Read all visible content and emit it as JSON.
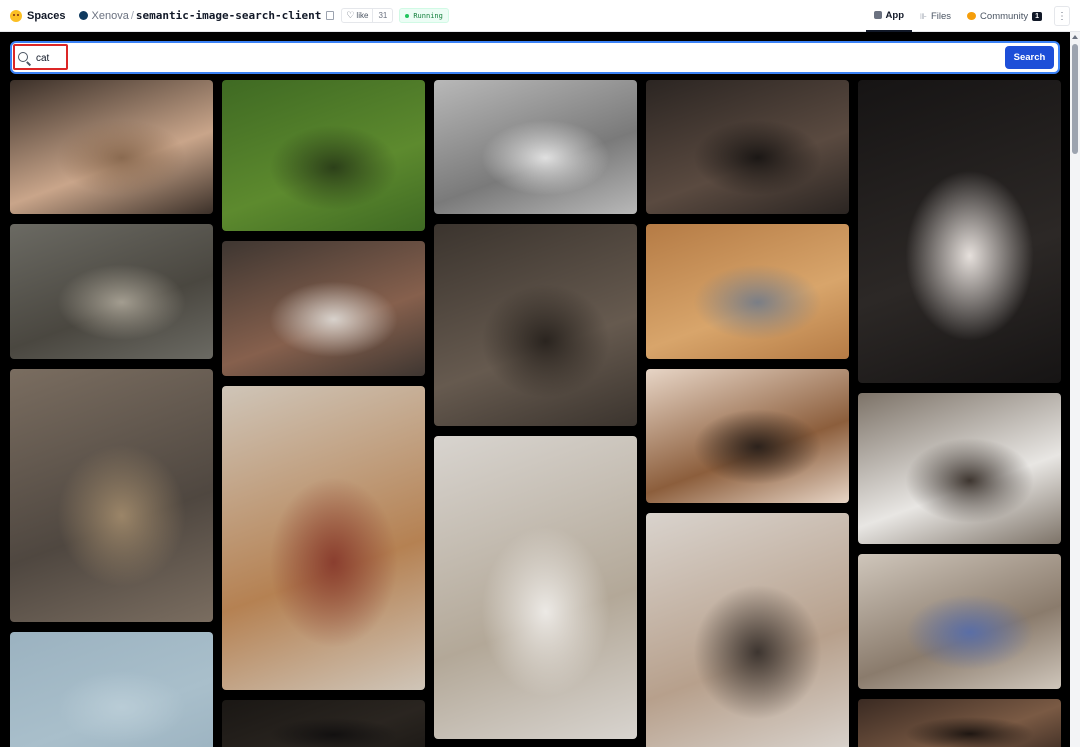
{
  "header": {
    "brand": "Spaces",
    "owner": "Xenova",
    "separator": "/",
    "repo": "semantic-image-search-client",
    "like_label": "like",
    "like_count": "31",
    "status": "Running",
    "tabs": [
      {
        "label": "App",
        "icon": "app-icon",
        "active": true
      },
      {
        "label": "Files",
        "icon": "files-icon",
        "active": false
      },
      {
        "label": "Community",
        "icon": "community-icon",
        "active": false,
        "badge": "1"
      }
    ]
  },
  "search": {
    "value": "cat",
    "button_label": "Search",
    "accent_color": "#3b82f6",
    "button_color": "#1d4ed8"
  },
  "results": {
    "columns": [
      [
        {
          "desc": "ginger cat sleeping on a wooden shelf by a window",
          "colors": [
            "#3b3029",
            "#c9a58a",
            "#8a6a50"
          ]
        },
        {
          "desc": "tabby cat walking on a cobblestone street",
          "colors": [
            "#6b6a63",
            "#4a4740",
            "#a39d90"
          ]
        },
        {
          "desc": "tabby cat peeking out of a cardboard box",
          "colors": [
            "#7a6d60",
            "#4f4740",
            "#9b8568"
          ]
        },
        {
          "desc": "pale blue sky",
          "colors": [
            "#9bb2c0",
            "#a9bfcb",
            "#b9ccd6"
          ]
        }
      ],
      [
        {
          "desc": "tortoiseshell cat standing in green grass",
          "colors": [
            "#3f6a23",
            "#5d8a2e",
            "#2c4019"
          ]
        },
        {
          "desc": "white cat walking near flower pots",
          "colors": [
            "#3e3631",
            "#86604d",
            "#d8d2cc"
          ]
        },
        {
          "desc": "orange cat sitting on a red tiled floor",
          "colors": [
            "#cfc5b8",
            "#b58152",
            "#8a3e2f"
          ]
        },
        {
          "desc": "dark indoor scene",
          "colors": [
            "#1a1714",
            "#2a2520",
            "#121010"
          ]
        }
      ],
      [
        {
          "desc": "black and white photo of a tabby cat on a sidewalk",
          "colors": [
            "#b8b8b8",
            "#7a7a7a",
            "#e0e0e0"
          ]
        },
        {
          "desc": "grey tabby cat close-up by a scratching post",
          "colors": [
            "#3b342e",
            "#665a4f",
            "#2a241f"
          ]
        },
        {
          "desc": "tabby cat sleeping on a beige couch",
          "colors": [
            "#d8d4cf",
            "#b3a898",
            "#ece9e5"
          ]
        }
      ],
      [
        {
          "desc": "black and white cat lying on a bed",
          "colors": [
            "#2b2522",
            "#5a4a40",
            "#1b1715"
          ]
        },
        {
          "desc": "grey British shorthair lying on a wooden floor",
          "colors": [
            "#b57b45",
            "#d8a56b",
            "#7a7e86"
          ]
        },
        {
          "desc": "tabby cat crouching under a chair",
          "colors": [
            "#e7d5c6",
            "#8c5e3c",
            "#2c221c"
          ]
        },
        {
          "desc": "siamese cat sitting by a window",
          "colors": [
            "#d9d3cd",
            "#b7a08c",
            "#3d3530"
          ]
        }
      ],
      [
        {
          "desc": "ragdoll cat looking up next to a white chair",
          "colors": [
            "#161414",
            "#2c2826",
            "#e6e0dc"
          ]
        },
        {
          "desc": "white and grey fluffy cat sitting on a porch",
          "colors": [
            "#7d7368",
            "#e8e6e3",
            "#3e3630"
          ]
        },
        {
          "desc": "white persian cat in a kitchen corner",
          "colors": [
            "#cfc6bb",
            "#8a7b6c",
            "#5a6ea6"
          ]
        },
        {
          "desc": "close-up of a cat's ears",
          "colors": [
            "#3a2a22",
            "#7a5a44",
            "#1e1612"
          ]
        }
      ]
    ]
  }
}
